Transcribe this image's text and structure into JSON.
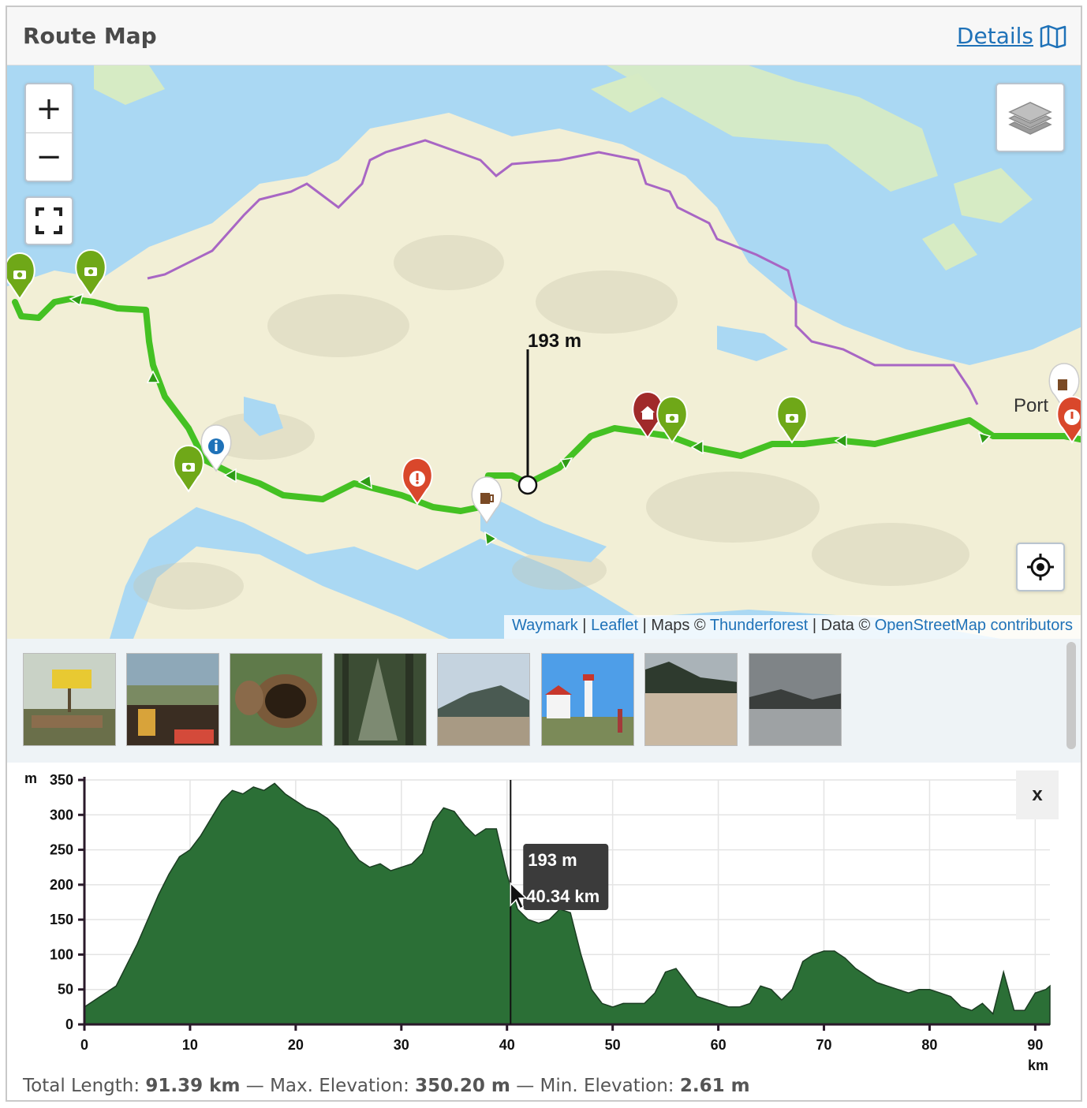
{
  "header": {
    "title": "Route Map",
    "details_label": "Details"
  },
  "map": {
    "zoom_in_label": "+",
    "zoom_out_label": "−",
    "hover_elevation_label": "193 m",
    "place_label": "Port",
    "attribution": {
      "waymark": "Waymark",
      "sep1": " | ",
      "leaflet": "Leaflet",
      "maps_text": " | Maps © ",
      "thunderforest": "Thunderforest",
      "data_text": " | Data © ",
      "osm": "OpenStreetMap contributors"
    },
    "colors": {
      "water": "#aad8f3",
      "land": "#f2efd6",
      "forest_land": "#dcebc4",
      "route": "#44c123",
      "boundary": "#a866c4",
      "marker_green": "#6fa818",
      "marker_red": "#d9472b",
      "marker_darkred": "#a02a2a"
    },
    "markers": [
      {
        "type": "camera",
        "color": "green",
        "icon": "camera-icon"
      },
      {
        "type": "camera",
        "color": "green",
        "icon": "camera-icon"
      },
      {
        "type": "info",
        "color": "white",
        "icon": "info-icon"
      },
      {
        "type": "camera",
        "color": "green",
        "icon": "camera-icon"
      },
      {
        "type": "warning",
        "color": "red",
        "icon": "exclamation-icon"
      },
      {
        "type": "pub",
        "color": "white",
        "icon": "beer-mug-icon"
      },
      {
        "type": "shelter",
        "color": "darkred",
        "icon": "house-icon"
      },
      {
        "type": "camera",
        "color": "green",
        "icon": "camera-icon"
      },
      {
        "type": "camera",
        "color": "green",
        "icon": "camera-icon"
      },
      {
        "type": "pub",
        "color": "white",
        "icon": "beer-mug-icon"
      },
      {
        "type": "warning",
        "color": "red",
        "icon": "exclamation-icon"
      }
    ]
  },
  "gallery": {
    "photos": [
      {
        "icon": "photo-sign-icon"
      },
      {
        "icon": "photo-beer-icon"
      },
      {
        "icon": "photo-log-icon"
      },
      {
        "icon": "photo-forest-icon"
      },
      {
        "icon": "photo-beach-icon"
      },
      {
        "icon": "photo-lighthouse-icon"
      },
      {
        "icon": "photo-sand-icon"
      },
      {
        "icon": "photo-lake-icon"
      }
    ]
  },
  "chart_data": {
    "type": "area",
    "ylabel": "m",
    "xlabel": "km",
    "ylim": [
      0,
      350
    ],
    "xlim": [
      0,
      91.39
    ],
    "yticks": [
      0,
      50,
      100,
      150,
      200,
      250,
      300,
      350
    ],
    "xticks": [
      0,
      10,
      20,
      30,
      40,
      50,
      60,
      70,
      80,
      90
    ],
    "grid": true,
    "fill_color": "#2b6f36",
    "x": [
      0,
      1,
      2,
      3,
      4,
      5,
      6,
      7,
      8,
      9,
      10,
      11,
      12,
      13,
      14,
      15,
      16,
      17,
      18,
      19,
      20,
      21,
      22,
      23,
      24,
      25,
      26,
      27,
      28,
      29,
      30,
      31,
      32,
      33,
      34,
      35,
      36,
      37,
      38,
      39,
      40,
      41,
      42,
      43,
      44,
      45,
      46,
      47,
      48,
      49,
      50,
      51,
      52,
      53,
      54,
      55,
      56,
      57,
      58,
      59,
      60,
      61,
      62,
      63,
      64,
      65,
      66,
      67,
      68,
      69,
      70,
      71,
      72,
      73,
      74,
      75,
      76,
      77,
      78,
      79,
      80,
      81,
      82,
      83,
      84,
      85,
      86,
      87,
      88,
      89,
      90,
      91,
      91.39
    ],
    "y": [
      25,
      35,
      45,
      55,
      85,
      115,
      150,
      185,
      215,
      240,
      250,
      270,
      295,
      320,
      335,
      330,
      340,
      335,
      345,
      330,
      320,
      310,
      305,
      295,
      280,
      255,
      235,
      225,
      230,
      220,
      225,
      230,
      245,
      290,
      310,
      305,
      285,
      270,
      280,
      280,
      215,
      165,
      150,
      145,
      150,
      165,
      160,
      100,
      50,
      30,
      25,
      30,
      30,
      30,
      45,
      75,
      80,
      60,
      40,
      35,
      30,
      25,
      25,
      30,
      55,
      50,
      35,
      50,
      90,
      100,
      105,
      105,
      95,
      80,
      70,
      60,
      55,
      50,
      45,
      50,
      50,
      45,
      40,
      25,
      20,
      30,
      15,
      75,
      20,
      20,
      45,
      50,
      55
    ],
    "cursor": {
      "x": 40.34,
      "y": 193
    },
    "tooltip_elevation": "193 m",
    "tooltip_distance": "40.34 km"
  },
  "close_label": "x",
  "summary": {
    "length_label": "Total Length:",
    "length_value": "91.39 km",
    "sep1": " — ",
    "max_label": "Max. Elevation:",
    "max_value": "350.20 m",
    "sep2": " — ",
    "min_label": "Min. Elevation:",
    "min_value": "2.61 m"
  }
}
